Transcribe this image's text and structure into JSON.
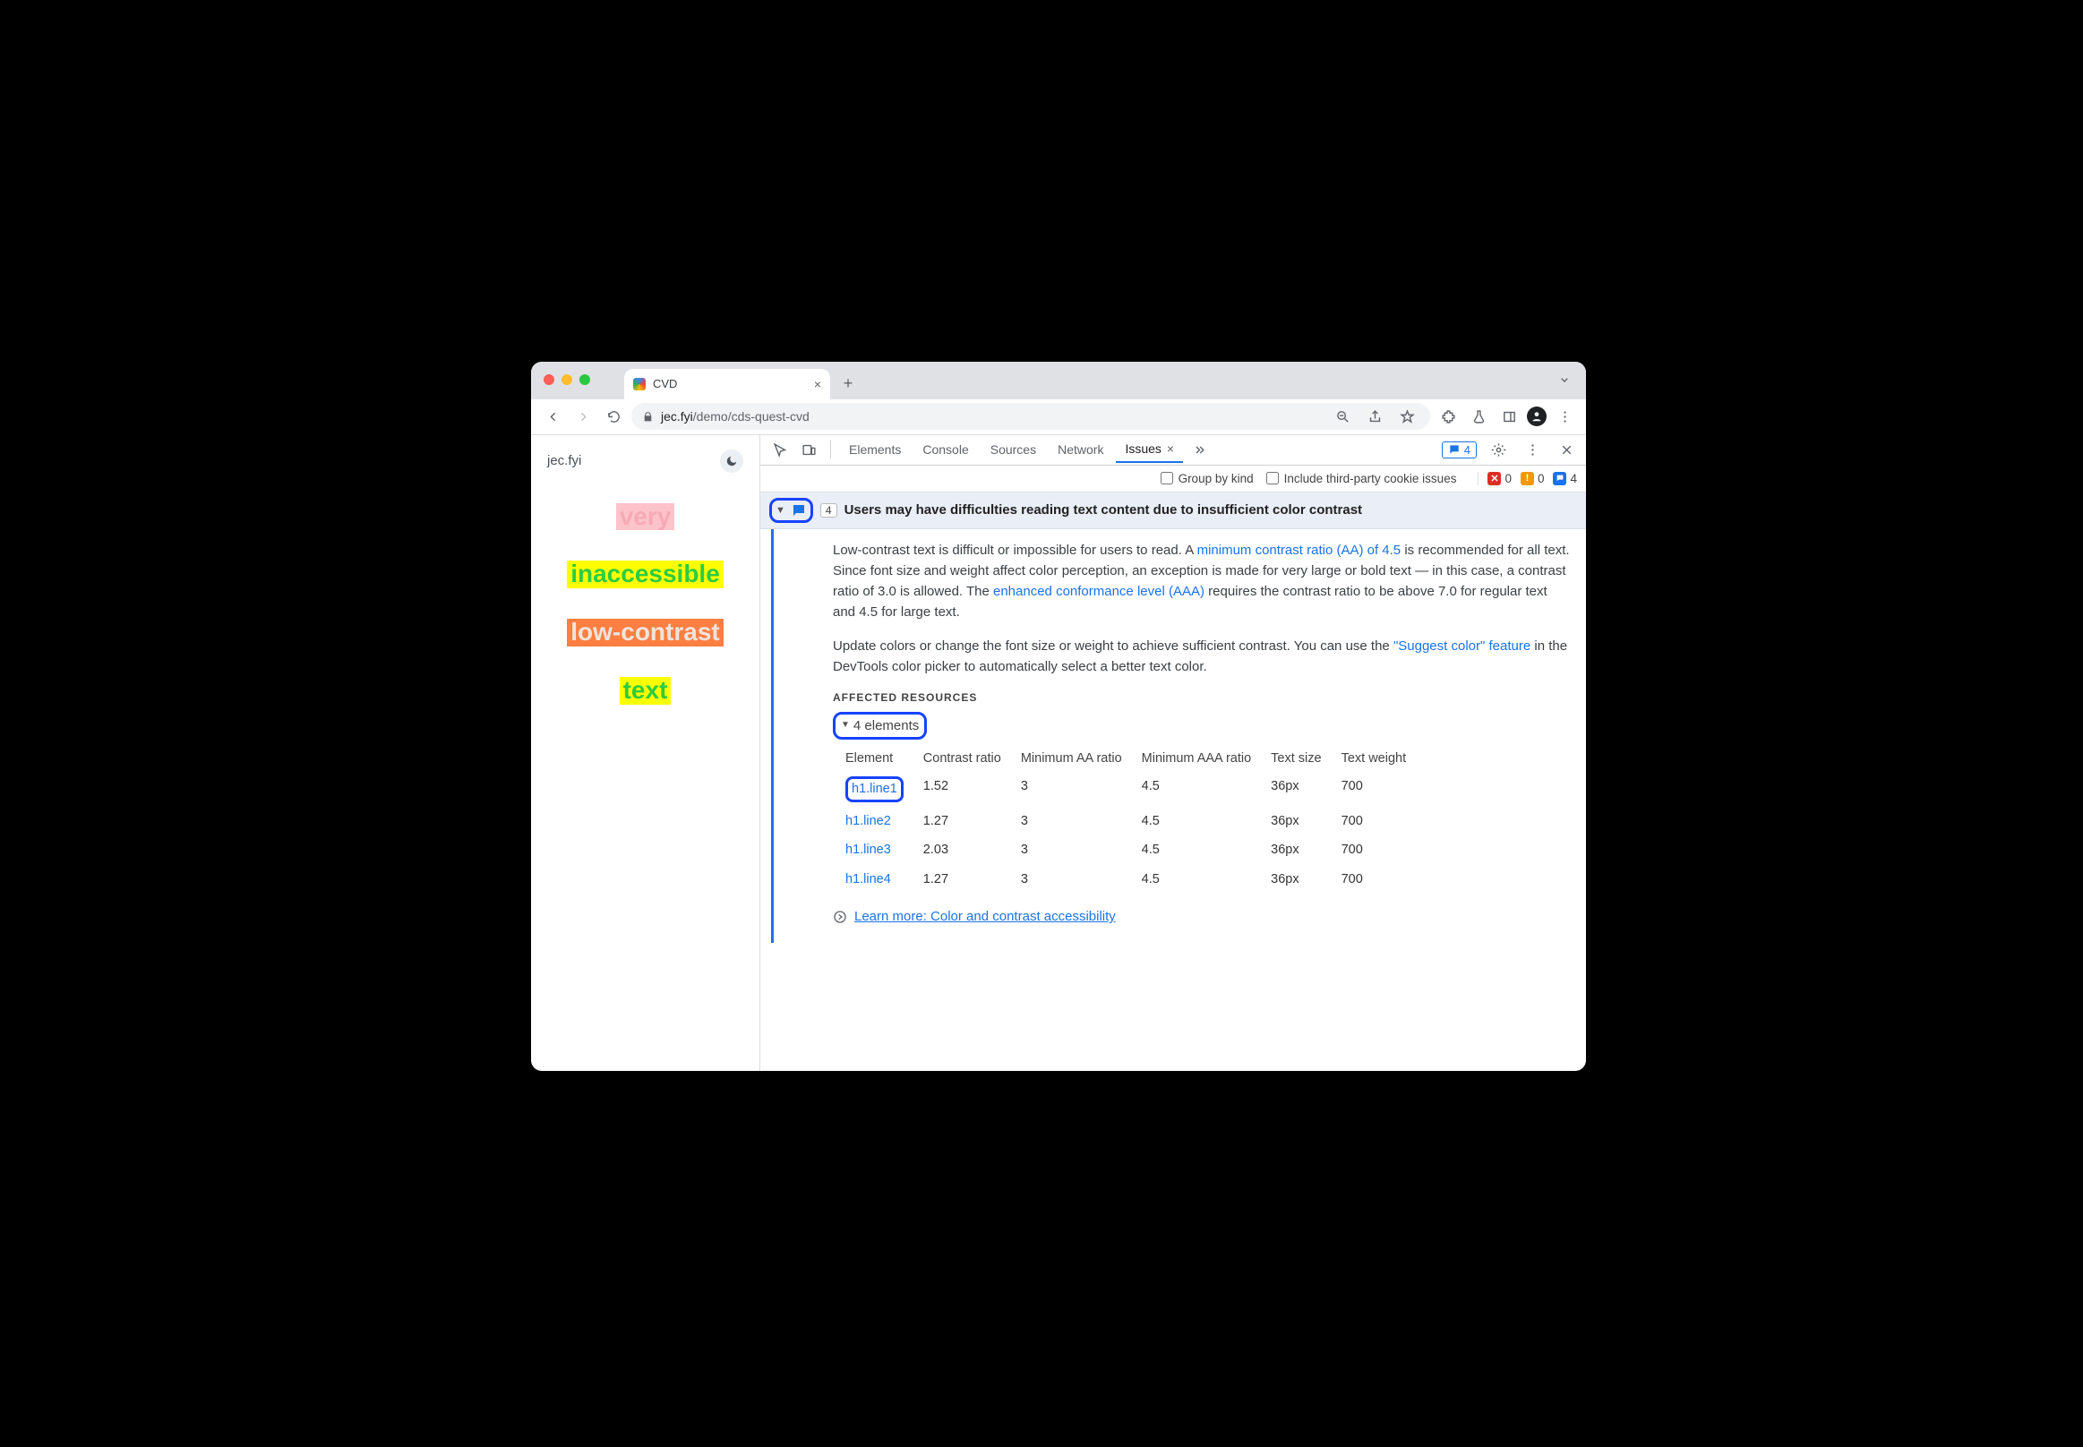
{
  "browser": {
    "tab_title": "CVD",
    "url_host": "jec.fyi",
    "url_path": "/demo/cds-quest-cvd"
  },
  "page": {
    "site_label": "jec.fyi",
    "words": [
      "very",
      "inaccessible",
      "low-contrast",
      "text"
    ]
  },
  "devtools": {
    "tabs": [
      "Elements",
      "Console",
      "Sources",
      "Network",
      "Issues"
    ],
    "active_tab": "Issues",
    "badge_count": "4",
    "subbar": {
      "group_by_kind": "Group by kind",
      "include_3p": "Include third-party cookie issues",
      "err_count": "0",
      "warn_count": "0",
      "info_count": "4"
    }
  },
  "issue": {
    "count": "4",
    "title": "Users may have difficulties reading text content due to insufficient color contrast",
    "p1a": "Low-contrast text is difficult or impossible for users to read. A ",
    "p1_link1": "minimum contrast ratio (AA) of 4.5",
    "p1b": " is recommended for all text. Since font size and weight affect color perception, an exception is made for very large or bold text — in this case, a contrast ratio of 3.0 is allowed. The ",
    "p1_link2": "enhanced conformance level (AAA)",
    "p1c": " requires the contrast ratio to be above 7.0 for regular text and 4.5 for large text.",
    "p2a": "Update colors or change the font size or weight to achieve sufficient contrast. You can use the ",
    "p2_link": "\"Suggest color\" feature",
    "p2b": " in the DevTools color picker to automatically select a better text color.",
    "affected_label": "AFFECTED RESOURCES",
    "elements_summary": "4 elements",
    "table": {
      "headers": [
        "Element",
        "Contrast ratio",
        "Minimum AA ratio",
        "Minimum AAA ratio",
        "Text size",
        "Text weight"
      ],
      "rows": [
        {
          "el": "h1.line1",
          "cr": "1.52",
          "aa": "3",
          "aaa": "4.5",
          "size": "36px",
          "weight": "700"
        },
        {
          "el": "h1.line2",
          "cr": "1.27",
          "aa": "3",
          "aaa": "4.5",
          "size": "36px",
          "weight": "700"
        },
        {
          "el": "h1.line3",
          "cr": "2.03",
          "aa": "3",
          "aaa": "4.5",
          "size": "36px",
          "weight": "700"
        },
        {
          "el": "h1.line4",
          "cr": "1.27",
          "aa": "3",
          "aaa": "4.5",
          "size": "36px",
          "weight": "700"
        }
      ]
    },
    "learn_more": "Learn more: Color and contrast accessibility"
  }
}
